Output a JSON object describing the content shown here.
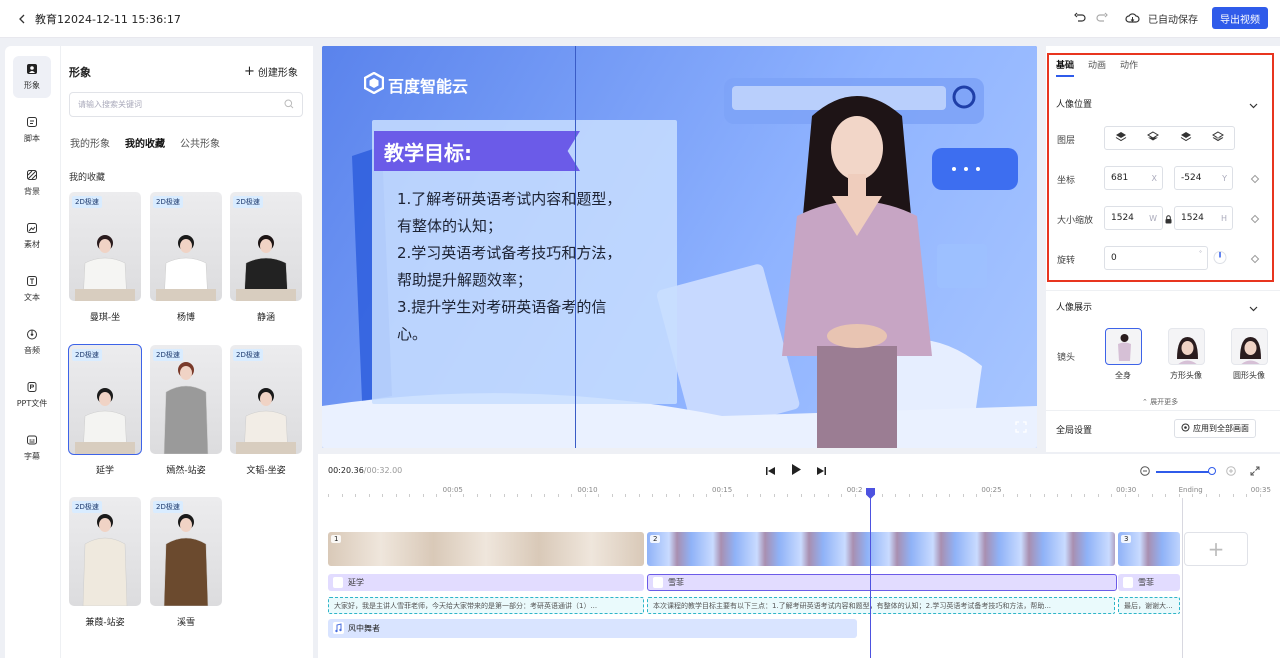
{
  "header": {
    "title": "教育12024-12-11 15:36:17",
    "autosave": "已自动保存",
    "export_label": "导出视频"
  },
  "leftnav": {
    "items": [
      {
        "label": "形象",
        "icon": "avatar-icon",
        "active": true
      },
      {
        "label": "脚本",
        "icon": "script-icon"
      },
      {
        "label": "背景",
        "icon": "background-icon"
      },
      {
        "label": "素材",
        "icon": "material-icon"
      },
      {
        "label": "文本",
        "icon": "text-icon"
      },
      {
        "label": "音频",
        "icon": "audio-icon"
      },
      {
        "label": "PPT文件",
        "icon": "ppt-icon"
      },
      {
        "label": "字幕",
        "icon": "subtitle-icon"
      }
    ]
  },
  "panel": {
    "title": "形象",
    "create_label": "创建形象",
    "search_placeholder": "请输入搜索关键词",
    "tabs": [
      "我的形象",
      "我的收藏",
      "公共形象"
    ],
    "section_title": "我的收藏",
    "badge": "2D极速",
    "cards": [
      {
        "name": "曼琪-坐"
      },
      {
        "name": "杨博"
      },
      {
        "name": "静涵"
      },
      {
        "name": "延学"
      },
      {
        "name": "嫣然-站姿"
      },
      {
        "name": "文韬-坐姿"
      },
      {
        "name": "兼葭-站姿"
      },
      {
        "name": "溪雪"
      }
    ]
  },
  "canvas": {
    "logo": "百度智能云",
    "ribbon": "教学目标:",
    "lines": [
      "1.了解考研英语考试内容和题型，",
      "有整体的认知；",
      "2.学习英语考试备考技巧和方法，",
      "帮助提升解题效率；",
      "3.提升学生对考研英语备考的信",
      "心。"
    ]
  },
  "right": {
    "tabs": [
      "基础",
      "动画",
      "动作"
    ],
    "position_section": "人像位置",
    "layer_label": "图层",
    "coord_label": "坐标",
    "x": "681",
    "x_unit": "X",
    "y": "-524",
    "y_unit": "Y",
    "size_label": "大小缩放",
    "w": "1524",
    "w_unit": "W",
    "h": "1524",
    "h_unit": "H",
    "rotate_label": "旋转",
    "rotate": "0",
    "display_section": "人像展示",
    "lens_label": "镜头",
    "lens": [
      "全身",
      "方形头像",
      "圆形头像"
    ],
    "expand": "展开更多",
    "global_label": "全局设置",
    "apply_label": "应用到全部画面"
  },
  "timeline": {
    "current": "00:20.36",
    "total": "/00:32.00",
    "ticks": [
      {
        "label": "00:05",
        "pos": 0.14
      },
      {
        "label": "00:10",
        "pos": 0.28
      },
      {
        "label": "00:15",
        "pos": 0.42
      },
      {
        "label": "00:2",
        "pos": 0.56
      },
      {
        "label": "00:25",
        "pos": 0.7
      },
      {
        "label": "00:30",
        "pos": 0.84
      },
      {
        "label": "Ending",
        "pos": 0.905
      },
      {
        "label": "00:35",
        "pos": 0.98
      }
    ],
    "clips": [
      {
        "num": "1"
      },
      {
        "num": "2"
      },
      {
        "num": "3"
      }
    ],
    "avatars": [
      "延学",
      "雪菲",
      "雪菲"
    ],
    "captions": [
      "大家好，我是主讲人雪菲老师，今天给大家带来的是第一部分：考研英语通讲（1）...",
      "本次课程的教学目标主要有以下三点：1.了解考研英语考试内容和题型，有整体的认知；2.学习英语考试备考技巧和方法，帮助...",
      "最后，谢谢大..."
    ],
    "music": "风中舞者",
    "playhead_fraction": 0.636
  },
  "colors": {
    "accent": "#2f5bea",
    "highlight": "#e8351f"
  }
}
